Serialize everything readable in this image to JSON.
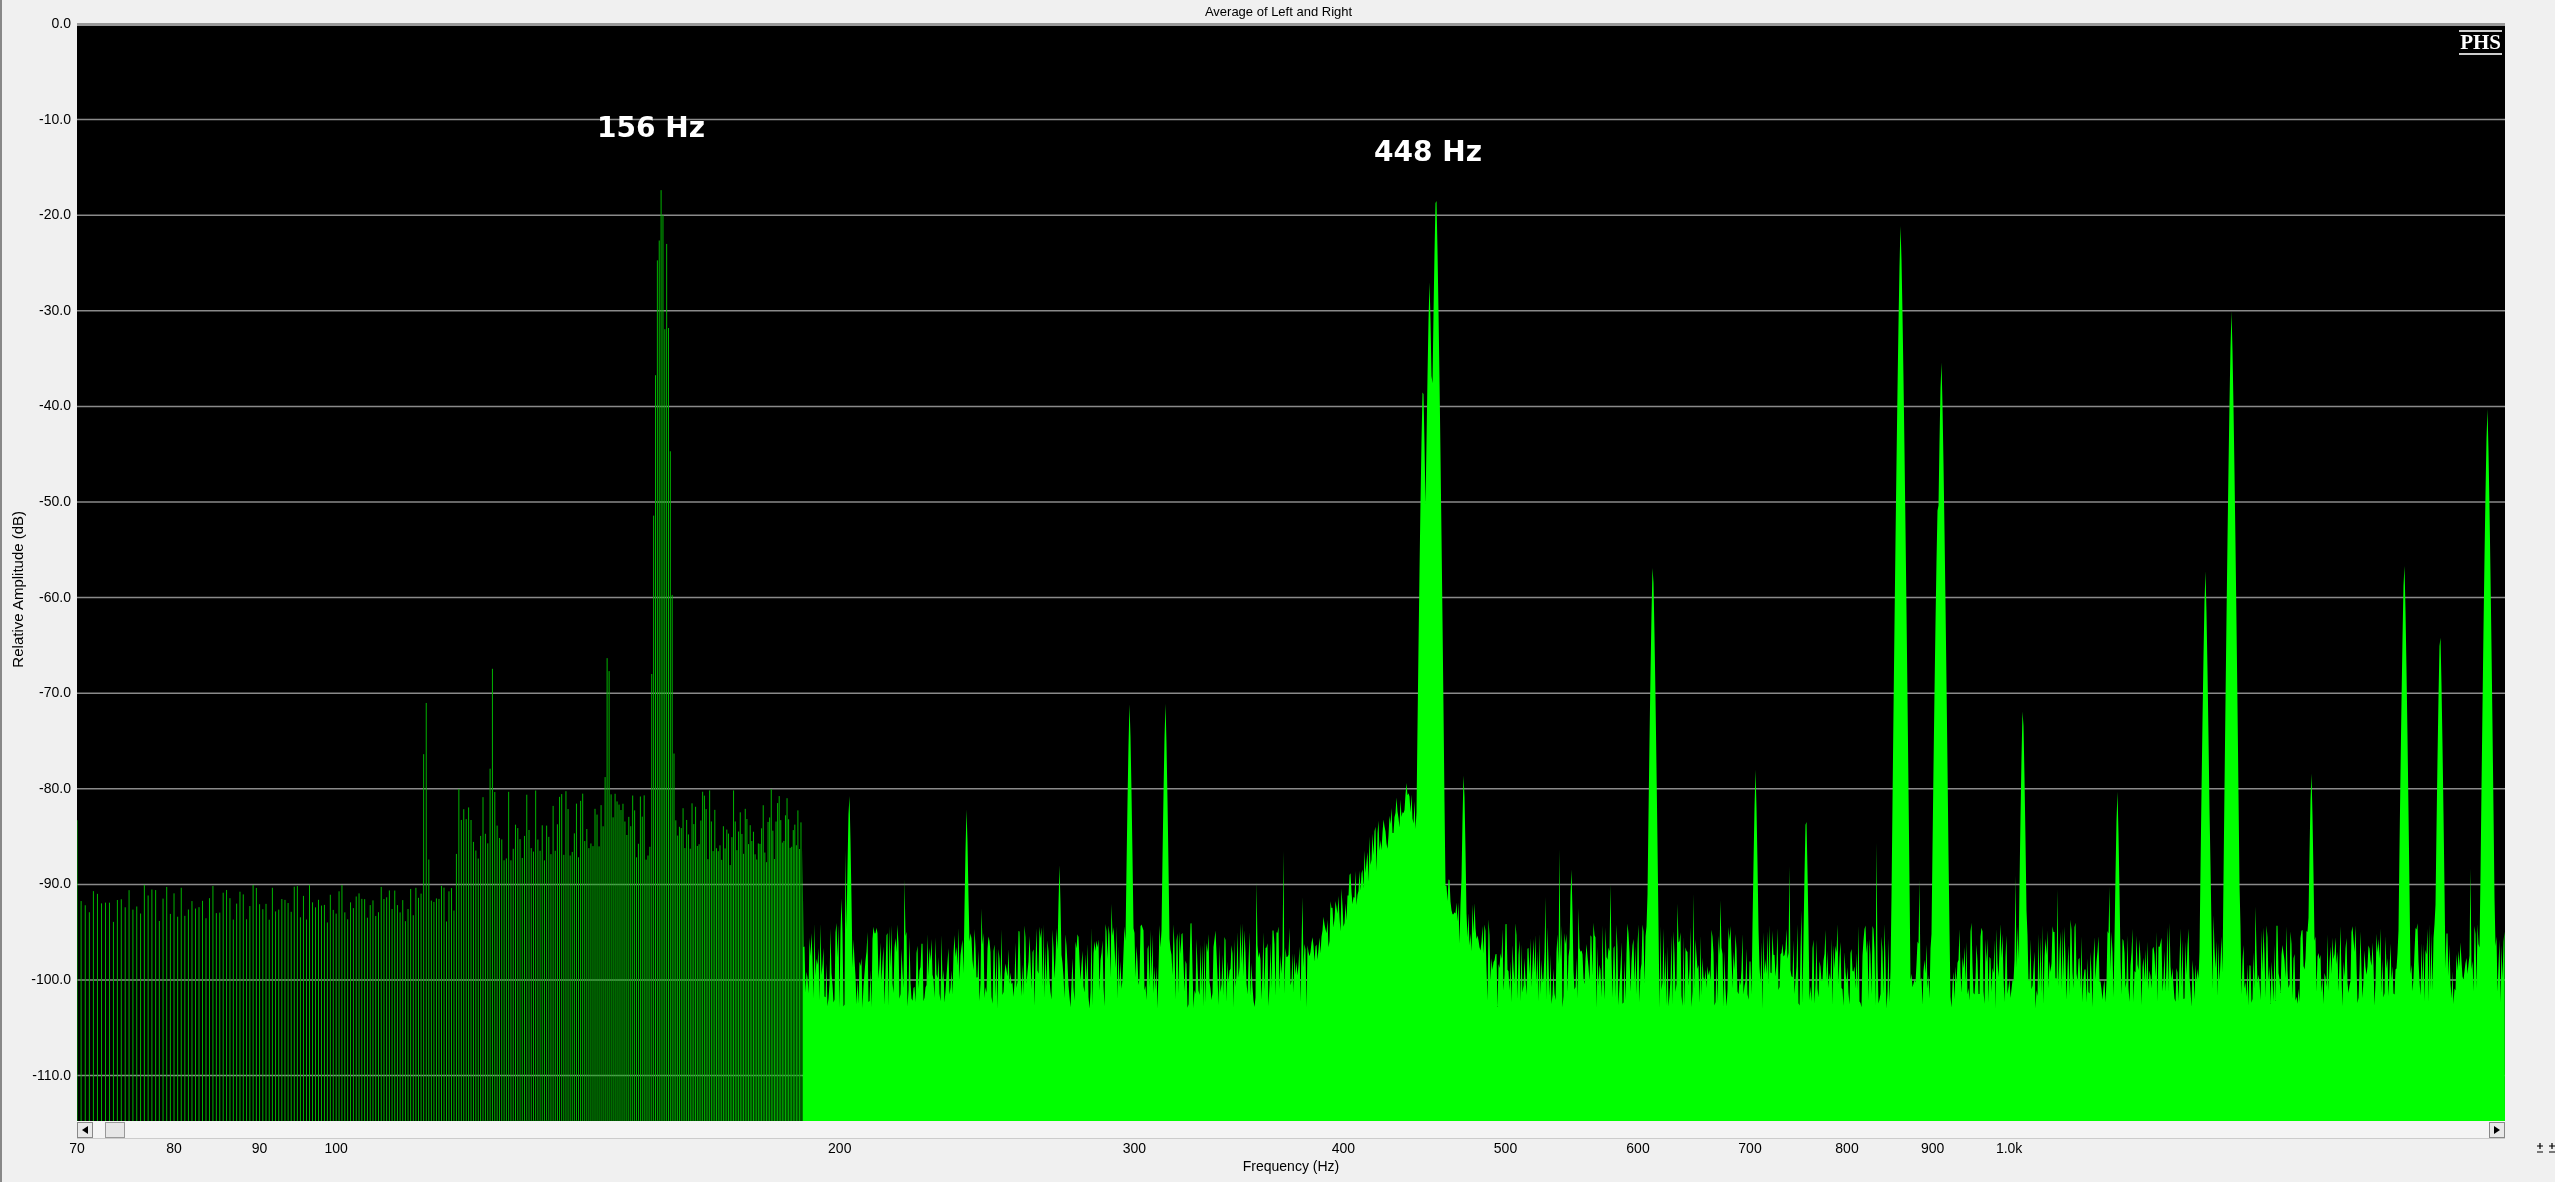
{
  "title": "Average of Left and Right",
  "logo": "PHS",
  "annotations": [
    "156 Hz",
    "448 Hz"
  ],
  "y_axis": {
    "label": "Relative Amplitude (dB)",
    "ticks": [
      "0.0",
      "-10.0",
      "-20.0",
      "-30.0",
      "-40.0",
      "-50.0",
      "-60.0",
      "-70.0",
      "-80.0",
      "-90.0",
      "-100.0",
      "-110.0"
    ]
  },
  "x_axis": {
    "label": "Frequency (Hz)",
    "ticks": [
      "70",
      "80",
      "90",
      "100",
      "200",
      "300",
      "400",
      "500",
      "600",
      "700",
      "800",
      "900",
      "1.0k"
    ]
  }
}
